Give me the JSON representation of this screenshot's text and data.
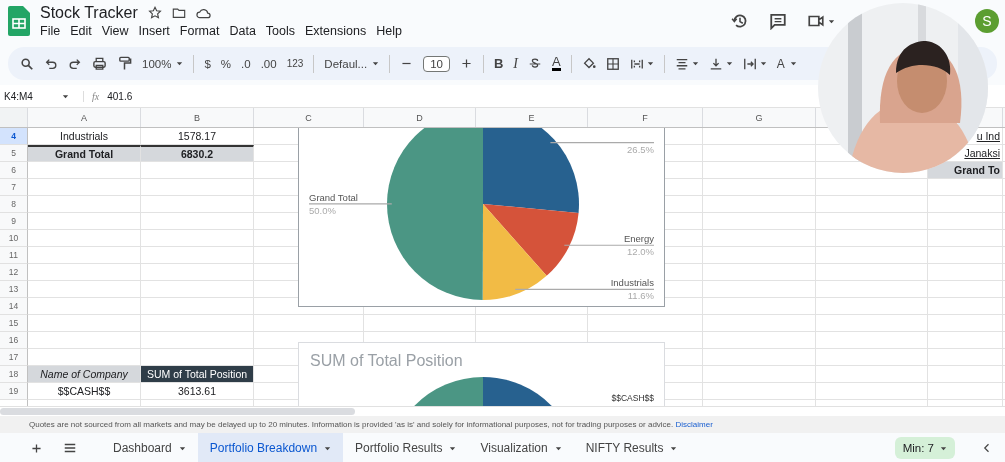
{
  "document": {
    "title": "Stock Tracker",
    "menu": [
      "File",
      "Edit",
      "View",
      "Insert",
      "Format",
      "Data",
      "Tools",
      "Extensions",
      "Help"
    ]
  },
  "account": {
    "initial": "S"
  },
  "toolbar": {
    "zoom": "100%",
    "currency": "$",
    "percent": "%",
    "decrease_decimals": ".0",
    "increase_decimals": ".00",
    "number_format": "123",
    "font": "Defaul...",
    "font_size": "10",
    "bold": "B",
    "italic": "I",
    "text_color": "A",
    "text_rotation": "A"
  },
  "formula_bar": {
    "cell_range": "K4:M4",
    "function_label": "fx",
    "value": "401.6"
  },
  "columns": [
    "A",
    "B",
    "C",
    "D",
    "E",
    "F",
    "G"
  ],
  "rows": [
    {
      "number": "4",
      "selected": true,
      "cells": [
        {
          "text": "Industrials",
          "kind": "plain"
        },
        {
          "text": "1578.17",
          "kind": "plain"
        }
      ],
      "edge_cell": {
        "text": "u Ind",
        "kind": "plain"
      }
    },
    {
      "number": "5",
      "selected": false,
      "cells": [
        {
          "text": "Grand Total",
          "kind": "total"
        },
        {
          "text": "6830.2",
          "kind": "total"
        }
      ],
      "edge_cell": {
        "text": "Janaksi",
        "kind": "plain"
      }
    },
    {
      "number": "6",
      "selected": false,
      "edge_cell": {
        "text": "Grand To",
        "kind": "total"
      }
    },
    {
      "number": "7",
      "selected": false
    },
    {
      "number": "8",
      "selected": false
    },
    {
      "number": "9",
      "selected": false
    },
    {
      "number": "10",
      "selected": false
    },
    {
      "number": "11",
      "selected": false
    },
    {
      "number": "12",
      "selected": false
    },
    {
      "number": "13",
      "selected": false
    },
    {
      "number": "14",
      "selected": false
    },
    {
      "number": "15",
      "selected": false
    },
    {
      "number": "16",
      "selected": false
    },
    {
      "number": "17",
      "selected": false
    },
    {
      "number": "18",
      "selected": false,
      "cells": [
        {
          "text": "Name of Company",
          "kind": "label"
        },
        {
          "text": "SUM of Total Position",
          "kind": "heading"
        }
      ]
    },
    {
      "number": "19",
      "selected": false,
      "cells": [
        {
          "text": "$$CASH$$",
          "kind": "plain"
        },
        {
          "text": "3613.61",
          "kind": "plain"
        }
      ]
    }
  ],
  "allocation_chart": {
    "chart_data": {
      "type": "pie",
      "categories": [
        null,
        "Energy",
        "Industrials",
        "Grand Total"
      ],
      "values": [
        26.5,
        12.0,
        11.6,
        50.0
      ],
      "colors": [
        "#27618f",
        "#d5533a",
        "#f2bb45",
        "#4b9684"
      ],
      "value_labels": [
        "26.5%",
        "12.0%",
        "11.6%",
        "50.0%"
      ]
    }
  },
  "position_chart": {
    "title": "SUM of Total Position",
    "label": "$$CASH$$"
  },
  "notice": {
    "text": "Quotes are not sourced from all markets and may be delayed up to 20 minutes. Information is provided 'as is' and solely for informational purposes, not for trading purposes or advice.",
    "link": "Disclaimer"
  },
  "sheet_tabs": [
    {
      "label": "Dashboard",
      "selected": false
    },
    {
      "label": "Portfolio Breakdown",
      "selected": true
    },
    {
      "label": "Portfolio Results",
      "selected": false
    },
    {
      "label": "Visualization",
      "selected": false
    },
    {
      "label": "NIFTY Results",
      "selected": false
    }
  ],
  "summary": "Min: 7"
}
